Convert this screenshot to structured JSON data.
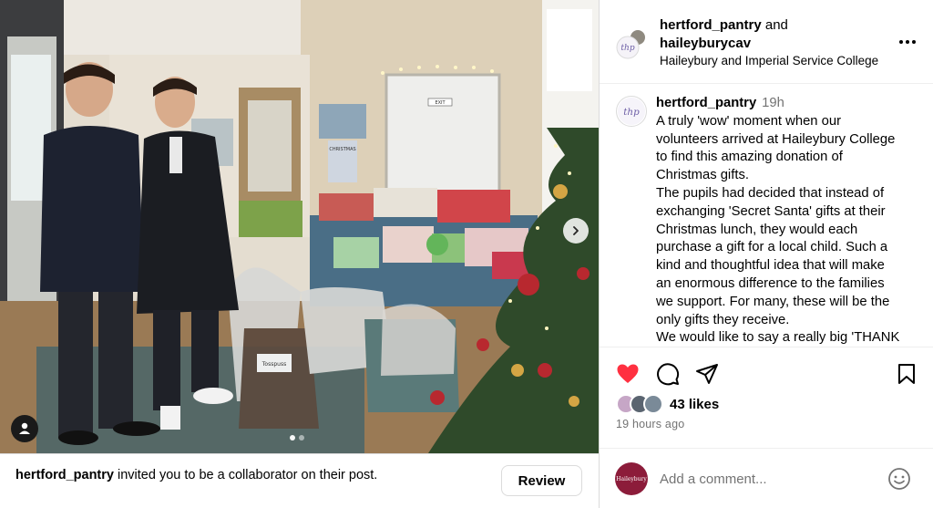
{
  "photo": {
    "alt_icons": {
      "user_tag": "person-icon",
      "next": "chevron-right-icon"
    },
    "bag_label": "Tosspuss",
    "door_sign": "EXIT",
    "poster_text": "CHRISTMAS"
  },
  "collaborator": {
    "username": "hertford_pantry",
    "message": " invited you to be a collaborator on their post.",
    "review_label": "Review"
  },
  "header": {
    "author": "hertford_pantry",
    "joiner": " and",
    "collaborator": "haileyburycav",
    "location": "Haileybury and Imperial Service College",
    "avatar_text": "thp"
  },
  "caption": {
    "username": "hertford_pantry",
    "time": "19h",
    "avatar_text": "thp",
    "lines": [
      "A truly 'wow' moment when our",
      "volunteers arrived at Haileybury College",
      "to find this amazing donation of",
      "Christmas gifts.",
      "The pupils had decided that instead of",
      "exchanging 'Secret Santa' gifts at their",
      "Christmas lunch, they would each",
      "purchase a gift for a local child. Such a",
      "kind and thoughtful idea that will make",
      "an enormous difference to the families",
      "we support. For many, these will be the",
      "only gifts they receive.",
      "We would like to say a really big 'THANK"
    ]
  },
  "actions": {
    "like_icon": "heart-icon",
    "comment_icon": "comment-icon",
    "share_icon": "share-icon",
    "save_icon": "bookmark-icon",
    "like_color": "#ff3040"
  },
  "engagement": {
    "likes": "43 likes",
    "time_ago": "19 hours ago"
  },
  "comment": {
    "placeholder": "Add a comment...",
    "avatar_text": "Haileybury",
    "emoji_icon": "emoji-icon",
    "avatar_color": "#8c1c3a"
  }
}
